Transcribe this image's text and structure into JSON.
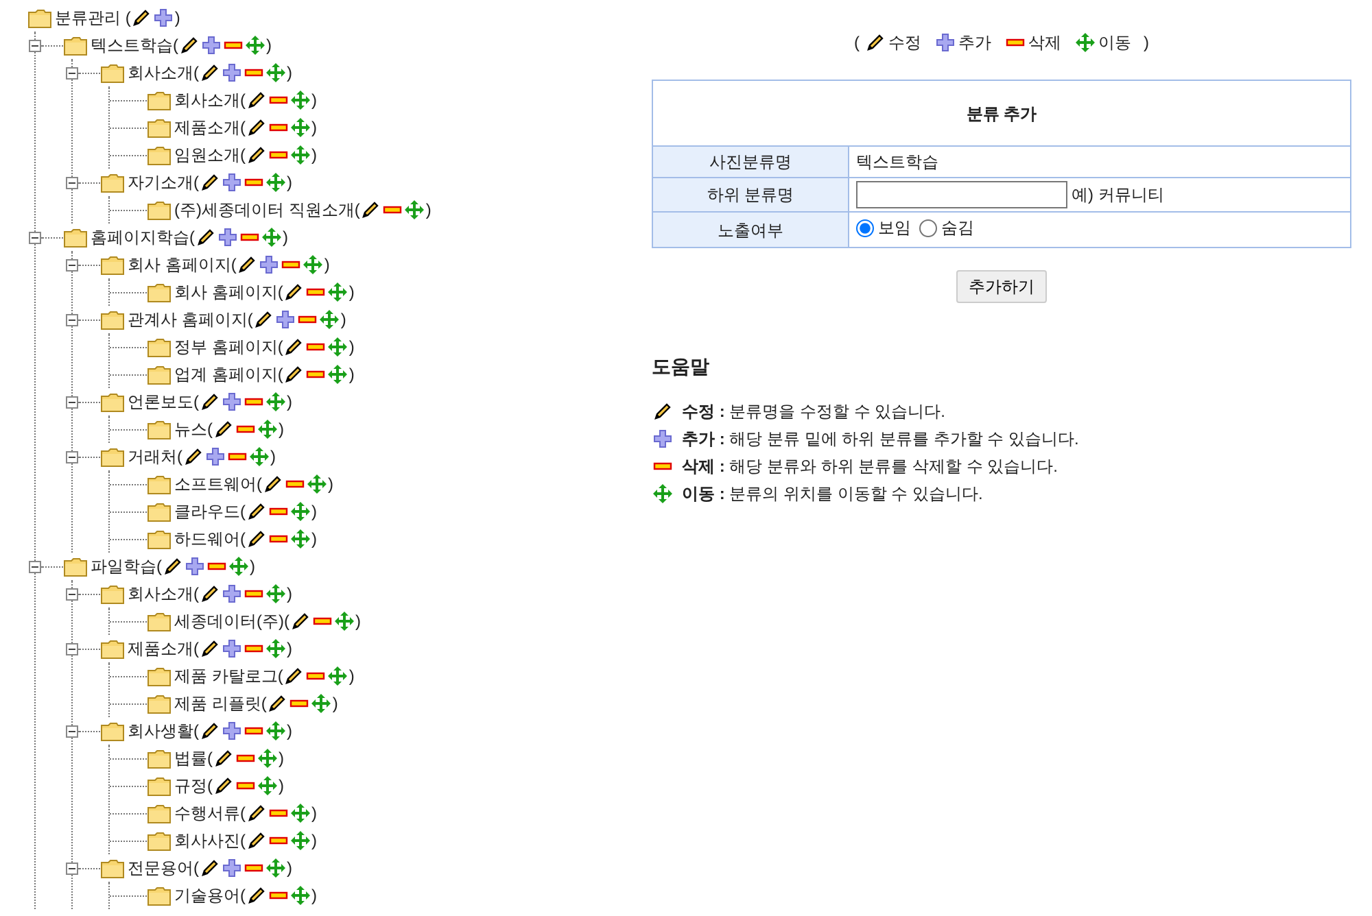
{
  "tree": {
    "label": "분류관리 (",
    "close": ")",
    "kind": "root",
    "children": [
      {
        "label": "텍스트학습(",
        "close": ")",
        "expanded": true,
        "kind": "branch",
        "children": [
          {
            "label": "회사소개(",
            "close": ")",
            "expanded": true,
            "kind": "branch",
            "children": [
              {
                "label": "회사소개(",
                "close": ")",
                "kind": "leaf"
              },
              {
                "label": "제품소개(",
                "close": ")",
                "kind": "leaf"
              },
              {
                "label": "임원소개(",
                "close": ")",
                "kind": "leaf"
              }
            ]
          },
          {
            "label": "자기소개(",
            "close": ")",
            "expanded": true,
            "kind": "branch",
            "children": [
              {
                "label": "(주)세종데이터 직원소개(",
                "close": ")",
                "kind": "leaf"
              }
            ]
          }
        ]
      },
      {
        "label": "홈페이지학습(",
        "close": ")",
        "expanded": true,
        "kind": "branch",
        "children": [
          {
            "label": "회사 홈페이지(",
            "close": ")",
            "expanded": true,
            "kind": "branch",
            "children": [
              {
                "label": "회사 홈페이지(",
                "close": ")",
                "kind": "leaf"
              }
            ]
          },
          {
            "label": "관계사 홈페이지(",
            "close": ")",
            "expanded": true,
            "kind": "branch",
            "children": [
              {
                "label": "정부 홈페이지(",
                "close": ")",
                "kind": "leaf"
              },
              {
                "label": "업계 홈페이지(",
                "close": ")",
                "kind": "leaf"
              }
            ]
          },
          {
            "label": "언론보도(",
            "close": ")",
            "expanded": true,
            "kind": "branch",
            "children": [
              {
                "label": "뉴스(",
                "close": ")",
                "kind": "leaf"
              }
            ]
          },
          {
            "label": "거래처(",
            "close": ")",
            "expanded": true,
            "kind": "branch",
            "children": [
              {
                "label": "소프트웨어(",
                "close": ")",
                "kind": "leaf"
              },
              {
                "label": "클라우드(",
                "close": ")",
                "kind": "leaf"
              },
              {
                "label": "하드웨어(",
                "close": ")",
                "kind": "leaf"
              }
            ]
          }
        ]
      },
      {
        "label": "파일학습(",
        "close": ")",
        "expanded": true,
        "kind": "branch",
        "children": [
          {
            "label": "회사소개(",
            "close": ")",
            "expanded": true,
            "kind": "branch",
            "children": [
              {
                "label": "세종데이터(주)(",
                "close": ")",
                "kind": "leaf"
              }
            ]
          },
          {
            "label": "제품소개(",
            "close": ")",
            "expanded": true,
            "kind": "branch",
            "children": [
              {
                "label": "제품 카탈로그(",
                "close": ")",
                "kind": "leaf"
              },
              {
                "label": "제품 리플릿(",
                "close": ")",
                "kind": "leaf"
              }
            ]
          },
          {
            "label": "회사생활(",
            "close": ")",
            "expanded": true,
            "kind": "branch",
            "children": [
              {
                "label": "법률(",
                "close": ")",
                "kind": "leaf"
              },
              {
                "label": "규정(",
                "close": ")",
                "kind": "leaf"
              },
              {
                "label": "수행서류(",
                "close": ")",
                "kind": "leaf"
              },
              {
                "label": "회사사진(",
                "close": ")",
                "kind": "leaf"
              }
            ]
          },
          {
            "label": "전문용어(",
            "close": ")",
            "expanded": true,
            "kind": "branch",
            "children": [
              {
                "label": "기술용어(",
                "close": ")",
                "kind": "leaf"
              }
            ]
          }
        ]
      }
    ]
  },
  "legend": {
    "open": "(",
    "close": ")",
    "items": [
      {
        "kind": "edit",
        "label": "수정"
      },
      {
        "kind": "add",
        "label": "추가"
      },
      {
        "kind": "delete",
        "label": "삭제"
      },
      {
        "kind": "move",
        "label": "이동"
      }
    ]
  },
  "form": {
    "title": "분류 추가",
    "rows": [
      {
        "kind": "text",
        "label": "사진분류명",
        "value": "텍스트학습"
      },
      {
        "kind": "input",
        "label": "하위 분류명",
        "hint": "예) 커뮤니티"
      },
      {
        "kind": "radio",
        "label": "노출여부",
        "options": [
          {
            "label": "보임",
            "selected": true
          },
          {
            "label": "숨김",
            "selected": false
          }
        ]
      }
    ],
    "button": "추가하기"
  },
  "help": {
    "title": "도움말",
    "items": [
      {
        "kind": "edit",
        "text": "**수정 :** 분류명을 수정할 수 있습니다."
      },
      {
        "kind": "add",
        "text": "**추가 :** 해당 분류 밑에 하위 분류를 추가할 수 있습니다."
      },
      {
        "kind": "delete",
        "text": "**삭제 :** 해당 분류와 하위 분류를 삭제할 수 있습니다."
      },
      {
        "kind": "move",
        "text": "**이동 :** 분류의 위치를 이동할 수 있습니다."
      }
    ]
  }
}
